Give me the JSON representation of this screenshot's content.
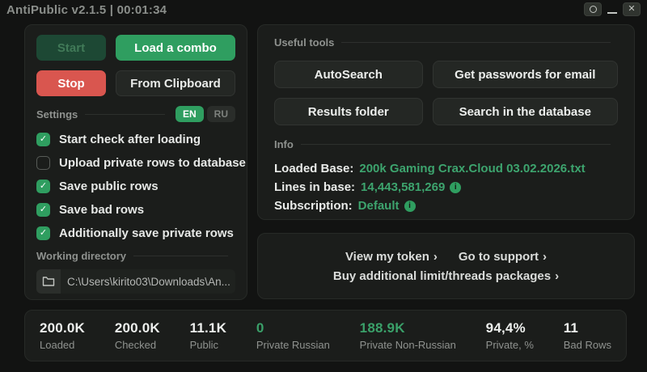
{
  "titlebar": {
    "title": "AntiPublic v2.1.5 | 00:01:34",
    "close_glyph": "✕"
  },
  "icons": {
    "check": "✓",
    "info": "i"
  },
  "left_panel": {
    "start_label": "Start",
    "load_combo_label": "Load a combo",
    "stop_label": "Stop",
    "from_clipboard_label": "From Clipboard",
    "settings_label": "Settings",
    "lang_en": "EN",
    "lang_ru": "RU",
    "checkboxes": [
      {
        "label": "Start check after loading",
        "checked": true
      },
      {
        "label": "Upload private rows to database",
        "checked": false
      },
      {
        "label": "Save public rows",
        "checked": true
      },
      {
        "label": "Save bad rows",
        "checked": true
      },
      {
        "label": "Additionally save private rows",
        "checked": true
      }
    ],
    "working_directory_label": "Working directory",
    "working_directory_path": "C:\\Users\\kirito03\\Downloads\\An..."
  },
  "tools_panel": {
    "title": "Useful tools",
    "buttons": [
      {
        "label": "AutoSearch"
      },
      {
        "label": "Get passwords for email"
      },
      {
        "label": "Results folder"
      },
      {
        "label": "Search in the database"
      }
    ],
    "info_title": "Info",
    "info_rows": [
      {
        "label": "Loaded Base:",
        "value": "200k Gaming Crax.Cloud 03.02.2026.txt",
        "icon": null
      },
      {
        "label": "Lines in base:",
        "value": "14,443,581,269",
        "icon": "i"
      },
      {
        "label": "Subscription:",
        "value": "Default",
        "icon": "i"
      }
    ]
  },
  "links_panel": {
    "links": [
      {
        "label": "View my token",
        "arrow": "›"
      },
      {
        "label": "Go to support",
        "arrow": "›"
      },
      {
        "label": "Buy additional limit/threads packages",
        "arrow": "›"
      }
    ]
  },
  "stats_bar": [
    {
      "value": "200.0K",
      "label": "Loaded",
      "green": false
    },
    {
      "value": "200.0K",
      "label": "Checked",
      "green": false
    },
    {
      "value": "11.1K",
      "label": "Public",
      "green": false
    },
    {
      "value": "0",
      "label": "Private Russian",
      "green": true
    },
    {
      "value": "188.9K",
      "label": "Private Non-Russian",
      "green": true
    },
    {
      "value": "94,4%",
      "label": "Private, %",
      "green": false
    },
    {
      "value": "11",
      "label": "Bad Rows",
      "green": false
    }
  ],
  "colors": {
    "accent_green": "#2f9e60",
    "stop_red": "#d9564f",
    "green_text": "#3da46e",
    "panel_bg": "#1b1d1b",
    "page_bg": "#121312"
  }
}
